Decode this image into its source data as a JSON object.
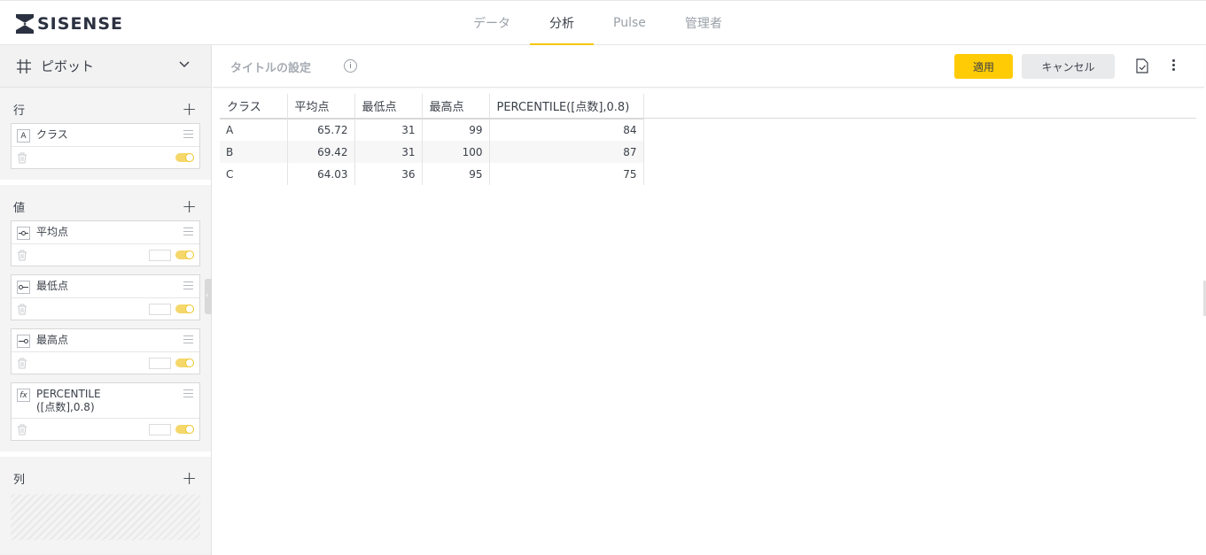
{
  "brand": {
    "logo_text": "SISENSE"
  },
  "nav": {
    "tabs": [
      {
        "label": "データ"
      },
      {
        "label": "分析"
      },
      {
        "label": "Pulse"
      },
      {
        "label": "管理者"
      }
    ],
    "active_tab": "分析"
  },
  "sidebar": {
    "widget_type": "ピボット",
    "rows_section": {
      "title": "行",
      "items": [
        {
          "type_icon": "A",
          "label": "クラス"
        }
      ]
    },
    "values_section": {
      "title": "値",
      "items": [
        {
          "type_icon": "avg-icon",
          "label": "平均点"
        },
        {
          "type_icon": "min-icon",
          "label": "最低点"
        },
        {
          "type_icon": "max-icon",
          "label": "最高点"
        },
        {
          "type_icon": "fx",
          "label": "PERCENTILE([点数],0.8)"
        }
      ]
    },
    "columns_section": {
      "title": "列"
    }
  },
  "toolbar": {
    "title_placeholder": "タイトルの設定",
    "apply_label": "適用",
    "cancel_label": "キャンセル"
  },
  "table": {
    "headers": [
      "クラス",
      "平均点",
      "最低点",
      "最高点",
      "PERCENTILE([点数],0.8)"
    ],
    "rows": [
      [
        "A",
        "65.72",
        "31",
        "99",
        "84"
      ],
      [
        "B",
        "69.42",
        "31",
        "100",
        "87"
      ],
      [
        "C",
        "64.03",
        "36",
        "95",
        "75"
      ]
    ]
  },
  "colors": {
    "accent": "#ffcb05",
    "toggle": "#f5d76a"
  }
}
